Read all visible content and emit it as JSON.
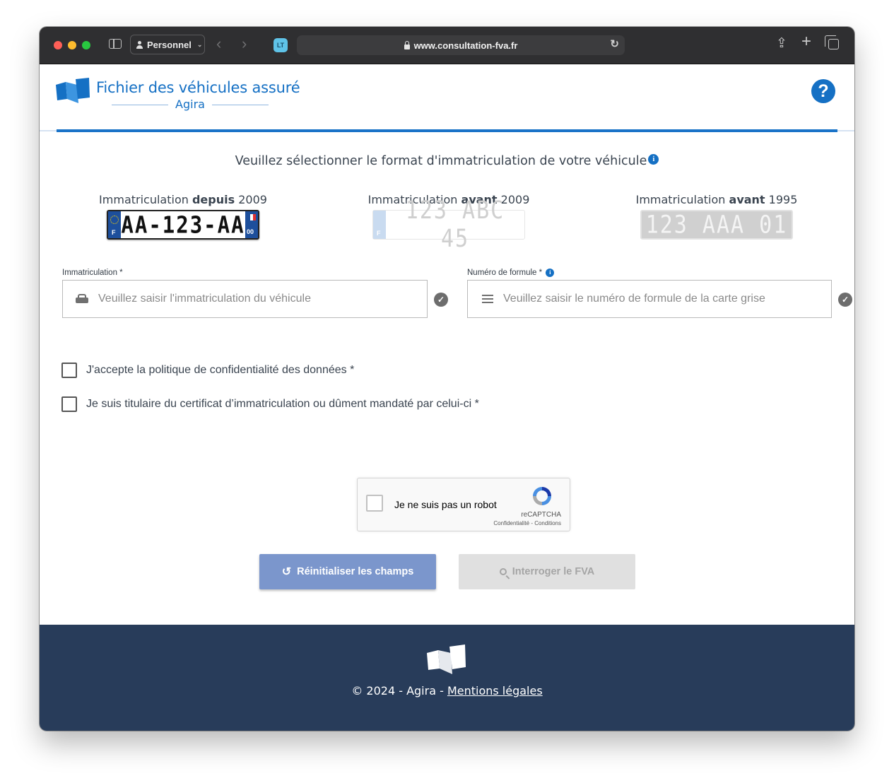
{
  "browser": {
    "profile": "Personnel",
    "url": "www.consultation-fva.fr",
    "ext_label": "LT"
  },
  "header": {
    "title": "Fichier des véhicules assuré",
    "subtitle": "Agira",
    "help": "?"
  },
  "main": {
    "prompt": "Veuillez sélectionner le format d'immatriculation de votre véhicule",
    "info": "i",
    "plates": [
      {
        "pre": "Immatriculation ",
        "bold": "depuis",
        "post": " 2009",
        "plate": "AA-123-AA"
      },
      {
        "pre": "Immatriculation ",
        "bold": "avant",
        "post": " 2009",
        "plate": "123 ABC 45"
      },
      {
        "pre": "Immatriculation ",
        "bold": "avant",
        "post": " 1995",
        "plate": "123 AAA 01"
      }
    ],
    "fields": {
      "immat_label": "Immatriculation *",
      "immat_placeholder": "Veuillez saisir l'immatriculation du véhicule",
      "formule_label": "Numéro de formule *",
      "formule_placeholder": "Veuillez saisir le numéro de formule de la carte grise",
      "check": "✓"
    },
    "checkboxes": [
      "J'accepte la politique de confidentialité des données *",
      "Je suis titulaire du certificat d’immatriculation ou dûment mandaté par celui-ci *"
    ],
    "recaptcha": {
      "label": "Je ne suis pas un robot",
      "brand": "reCAPTCHA",
      "terms": "Confidentialité - Conditions"
    },
    "buttons": {
      "reset": "Réinitialiser les champs",
      "query": "Interroger le FVA"
    }
  },
  "footer": {
    "copyright": "© 2024 - Agira - ",
    "legal": "Mentions légales"
  },
  "colors": {
    "brand_blue": "#1570c4",
    "footer_bg": "#283c5a",
    "reset_button": "#7b96cc"
  }
}
